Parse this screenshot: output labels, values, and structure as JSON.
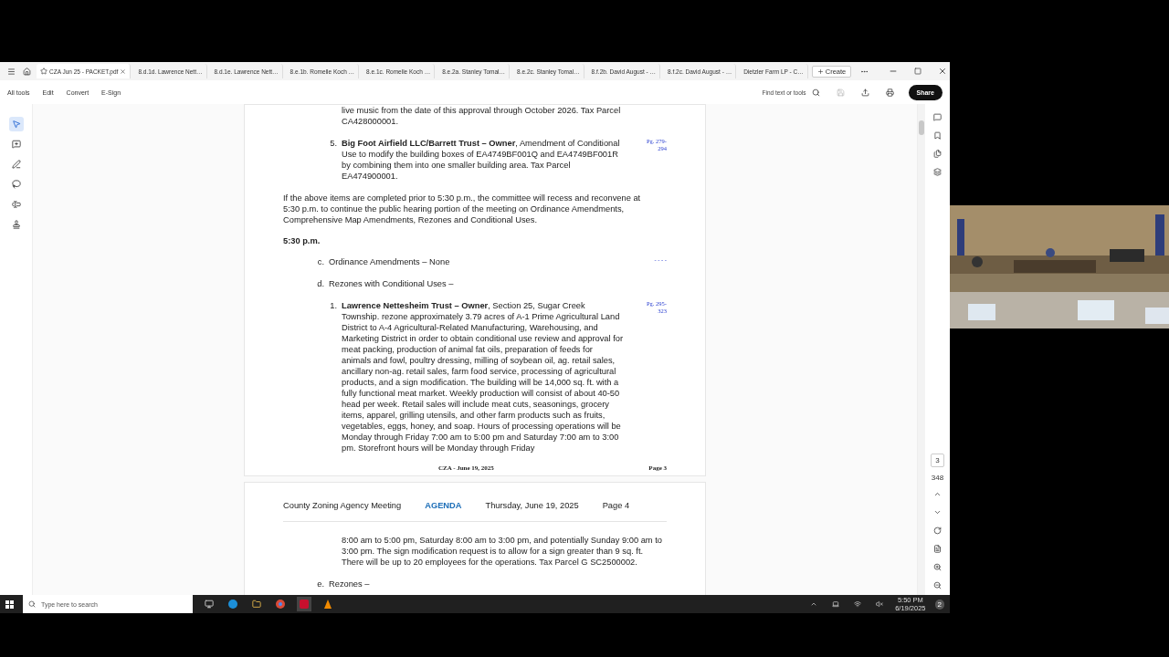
{
  "tabs": [
    {
      "label": "CZA Jun 25 - PACKET.pdf",
      "selected": true
    },
    {
      "label": "8.d.1d. Lawrence Nett…",
      "selected": false
    },
    {
      "label": "8.d.1e. Lawrence Nett…",
      "selected": false
    },
    {
      "label": "8.e.1b. Romelle Koch …",
      "selected": false
    },
    {
      "label": "8.e.1c. Romelle Koch …",
      "selected": false
    },
    {
      "label": "8.e.2a. Stanley Tomal…",
      "selected": false
    },
    {
      "label": "8.e.2c. Stanley Tomal…",
      "selected": false
    },
    {
      "label": "8.f.2b. David August - …",
      "selected": false
    },
    {
      "label": "8.f.2c. David August - …",
      "selected": false
    },
    {
      "label": "Dietzler Farm LP - C…",
      "selected": false
    }
  ],
  "create_button": "Create",
  "menu": [
    "All tools",
    "Edit",
    "Convert",
    "E-Sign"
  ],
  "search": {
    "placeholder": "Find text or tools"
  },
  "share_button": "Share",
  "tools": [
    {
      "kind": "pointer",
      "selected": true
    },
    {
      "kind": "comment",
      "selected": false
    },
    {
      "kind": "pen",
      "selected": false
    },
    {
      "kind": "lasso",
      "selected": false
    },
    {
      "kind": "text",
      "selected": false
    },
    {
      "kind": "stamp",
      "selected": false
    }
  ],
  "page3": {
    "items": [
      {
        "kind": "continuation",
        "text": "live music from the date of this approval through October 2026. Tax Parcel CA428000001."
      },
      {
        "kind": "numbered",
        "number": "5.",
        "text": "**Big Foot Airfield LLC/Barrett Trust – Owner**, Amendment of Conditional Use to modify the building boxes of EA4749BF001Q and EA4749BF001R by combining them into one smaller building area. Tax Parcel EA474900001.",
        "ref": [
          "Pg. 279-",
          "294"
        ]
      },
      {
        "kind": "paragraph",
        "text": "If the above items are completed prior to 5:30 p.m., the committee will recess and reconvene at 5:30 p.m. to continue the public hearing portion of the meeting on Ordinance Amendments, Comprehensive Map Amendments, Rezones and Conditional Uses."
      },
      {
        "kind": "heading",
        "text": "**5:30 p.m.**"
      },
      {
        "kind": "lettered",
        "letter": "c.",
        "text": "Ordinance Amendments – None",
        "ref": [
          "- - - -"
        ]
      },
      {
        "kind": "lettered",
        "letter": "d.",
        "text": "Rezones with Conditional Uses –"
      },
      {
        "kind": "numbered",
        "number": "1.",
        "text": "**Lawrence Nettesheim Trust – Owner**, Section 25, Sugar Creek Township. rezone approximately 3.79 acres of A-1 Prime Agricultural Land District to A-4 Agricultural-Related Manufacturing, Warehousing, and Marketing District in order to obtain conditional use review and approval for meat packing, production of animal fat oils, preparation of feeds for animals and fowl, poultry dressing, milling of soybean oil, ag. retail sales, ancillary non-ag. retail sales, farm food service, processing of agricultural products, and a sign modification. The building will be 14,000 sq. ft. with a fully functional meat market. Weekly production will consist of about 40-50 head per week. Retail sales will include meat cuts, seasonings, grocery items, apparel, grilling utensils, and other farm products such as fruits, vegetables, eggs, honey, and soap. Hours of processing operations will be Monday through Friday 7:00 am to 5:00 pm and Saturday 7:00 am to 3:00 pm. Storefront hours will be Monday through Friday",
        "ref": [
          "Pg. 295-",
          "323"
        ]
      }
    ],
    "footer": {
      "center": "CZA - June 19, 2025",
      "right": "Page 3"
    }
  },
  "page4": {
    "header": {
      "title": "County Zoning Agency Meeting",
      "agenda": "AGENDA",
      "date": "Thursday, June 19, 2025",
      "page": "Page 4"
    },
    "items": [
      {
        "kind": "continuation",
        "text": "8:00 am to 5:00 pm, Saturday 8:00 am to 3:00 pm, and potentially Sunday 9:00 am to 3:00 pm. The sign modification request is to allow for a sign greater than 9 sq. ft. There will be up to 20 employees for the operations. Tax Parcel G SC2500002."
      },
      {
        "kind": "lettered",
        "letter": "e.",
        "text": "Rezones –"
      }
    ]
  },
  "page_nav": {
    "current": "3",
    "total": "348"
  },
  "taskbar": {
    "search_placeholder": "Type here to search",
    "time": "5:50 PM",
    "date": "6/19/2025",
    "notifications": "2"
  }
}
